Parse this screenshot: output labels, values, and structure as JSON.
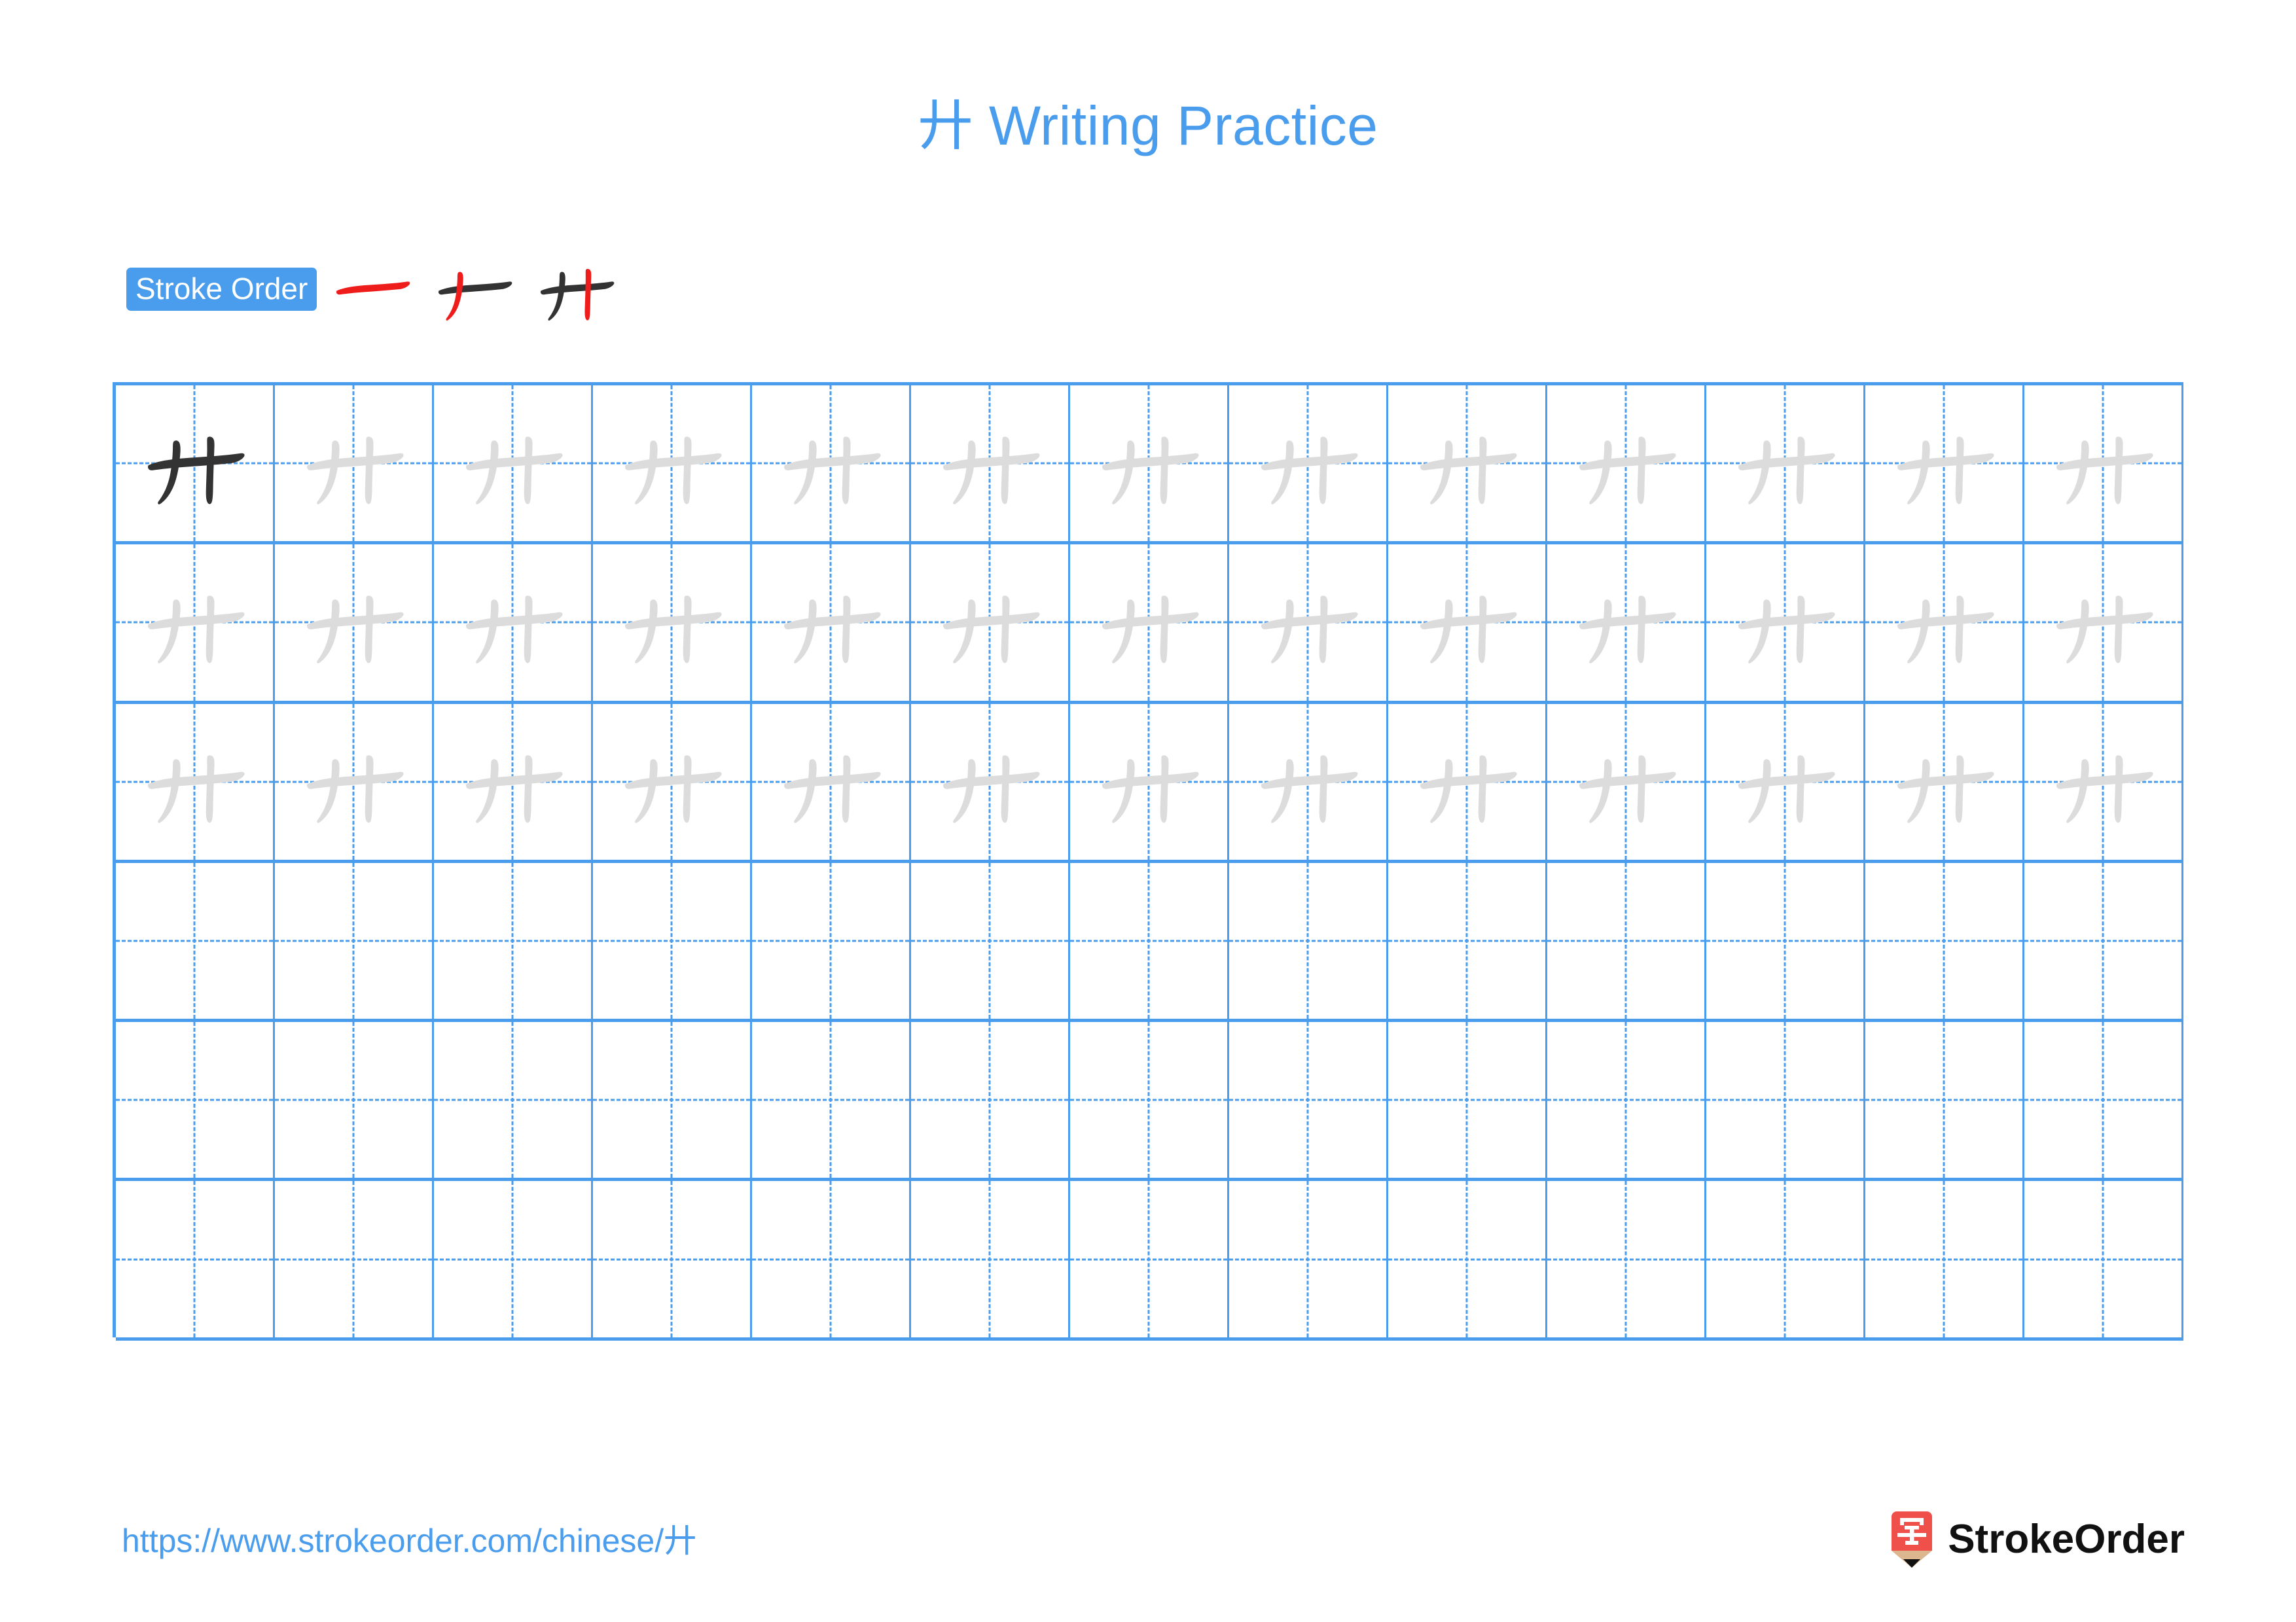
{
  "character": "廾",
  "title": "廾 Writing Practice",
  "colors": {
    "accent_blue": "#4a9ded",
    "grid_blue": "#4a9ded",
    "ink_dark": "#333333",
    "ink_trace": "#dcdcdc",
    "stroke_highlight_red": "#ef1c1c",
    "logo_red": "#f0504a",
    "logo_wood": "#dbb68f",
    "logo_tip": "#111111",
    "brand_text": "#111111"
  },
  "stroke_order": {
    "label": "Stroke Order",
    "total_strokes": 3,
    "steps": [
      {
        "index": 1,
        "name": "stroke-step-1",
        "new_stroke": "heng",
        "strokes_shown": 1
      },
      {
        "index": 2,
        "name": "stroke-step-2",
        "new_stroke": "pie",
        "strokes_shown": 2
      },
      {
        "index": 3,
        "name": "stroke-step-3",
        "new_stroke": "shu",
        "strokes_shown": 3
      }
    ]
  },
  "grid": {
    "columns": 13,
    "rows": 6,
    "rows_data": [
      {
        "index": 1,
        "name": "practice-row-1",
        "cells": [
          "dark",
          "trace",
          "trace",
          "trace",
          "trace",
          "trace",
          "trace",
          "trace",
          "trace",
          "trace",
          "trace",
          "trace",
          "trace"
        ]
      },
      {
        "index": 2,
        "name": "practice-row-2",
        "cells": [
          "trace",
          "trace",
          "trace",
          "trace",
          "trace",
          "trace",
          "trace",
          "trace",
          "trace",
          "trace",
          "trace",
          "trace",
          "trace"
        ]
      },
      {
        "index": 3,
        "name": "practice-row-3",
        "cells": [
          "trace",
          "trace",
          "trace",
          "trace",
          "trace",
          "trace",
          "trace",
          "trace",
          "trace",
          "trace",
          "trace",
          "trace",
          "trace"
        ]
      },
      {
        "index": 4,
        "name": "practice-row-4",
        "cells": [
          "empty",
          "empty",
          "empty",
          "empty",
          "empty",
          "empty",
          "empty",
          "empty",
          "empty",
          "empty",
          "empty",
          "empty",
          "empty"
        ]
      },
      {
        "index": 5,
        "name": "practice-row-5",
        "cells": [
          "empty",
          "empty",
          "empty",
          "empty",
          "empty",
          "empty",
          "empty",
          "empty",
          "empty",
          "empty",
          "empty",
          "empty",
          "empty"
        ]
      },
      {
        "index": 6,
        "name": "practice-row-6",
        "cells": [
          "empty",
          "empty",
          "empty",
          "empty",
          "empty",
          "empty",
          "empty",
          "empty",
          "empty",
          "empty",
          "empty",
          "empty",
          "empty"
        ]
      }
    ]
  },
  "footer": {
    "url": "https://www.strokeorder.com/chinese/廾",
    "brand_name": "StrokeOrder",
    "logo_glyph": "字"
  }
}
